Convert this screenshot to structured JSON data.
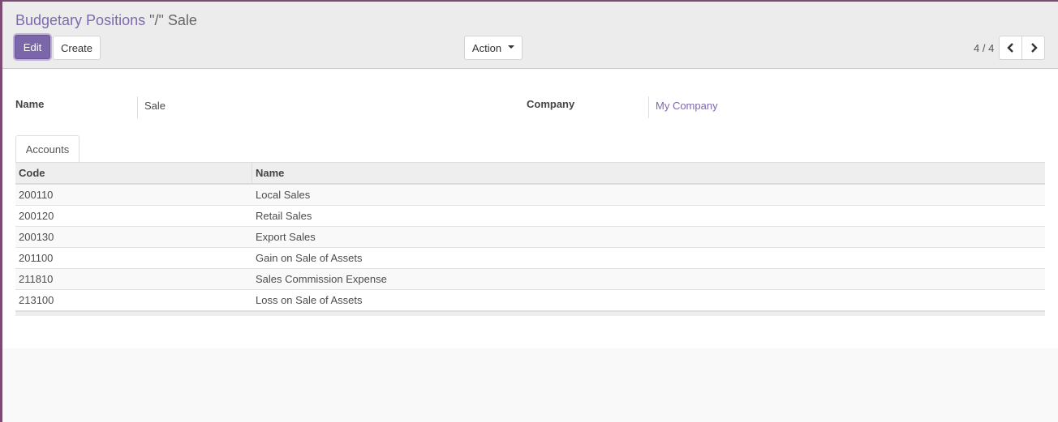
{
  "breadcrumb": {
    "parent": "Budgetary Positions",
    "separator": "\"/\"",
    "current": "Sale"
  },
  "toolbar": {
    "edit_label": "Edit",
    "create_label": "Create",
    "action_label": "Action"
  },
  "pager": {
    "value": "4 / 4"
  },
  "form": {
    "name_label": "Name",
    "name_value": "Sale",
    "company_label": "Company",
    "company_value": "My Company"
  },
  "tabs": [
    {
      "label": "Accounts"
    }
  ],
  "accounts_table": {
    "columns": [
      "Code",
      "Name"
    ],
    "rows": [
      {
        "code": "200110",
        "name": "Local Sales"
      },
      {
        "code": "200120",
        "name": "Retail Sales"
      },
      {
        "code": "200130",
        "name": "Export Sales"
      },
      {
        "code": "201100",
        "name": "Gain on Sale of Assets"
      },
      {
        "code": "211810",
        "name": "Sales Commission Expense"
      },
      {
        "code": "213100",
        "name": "Loss on Sale of Assets"
      }
    ]
  },
  "colors": {
    "accent": "#7c66aa",
    "link": "#7c6aab",
    "frame": "#7c4b73"
  }
}
